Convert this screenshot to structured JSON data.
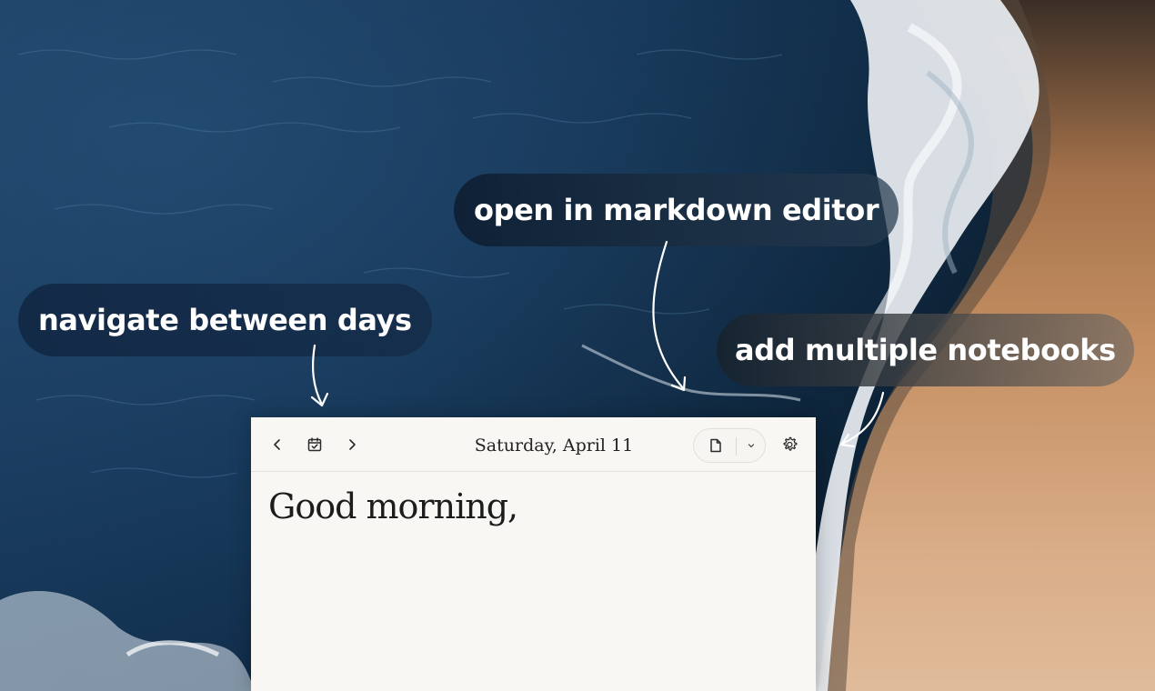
{
  "callouts": {
    "navigate": "navigate between days",
    "markdown": "open in markdown editor",
    "notebooks": "add multiple notebooks"
  },
  "toolbar": {
    "prev_icon": "chevron-left-icon",
    "calendar_icon": "calendar-check-icon",
    "next_icon": "chevron-right-icon",
    "date": "Saturday, April 11",
    "document_icon": "document-icon",
    "dropdown_icon": "chevron-down-icon",
    "settings_icon": "gear-icon"
  },
  "editor": {
    "greeting": "Good morning,"
  },
  "colors": {
    "ocean_deep": "#0d2238",
    "ocean_mid": "#1e4466",
    "sand": "#c89468",
    "foam": "#f2f5f7",
    "paper": "#f9f7f3"
  }
}
